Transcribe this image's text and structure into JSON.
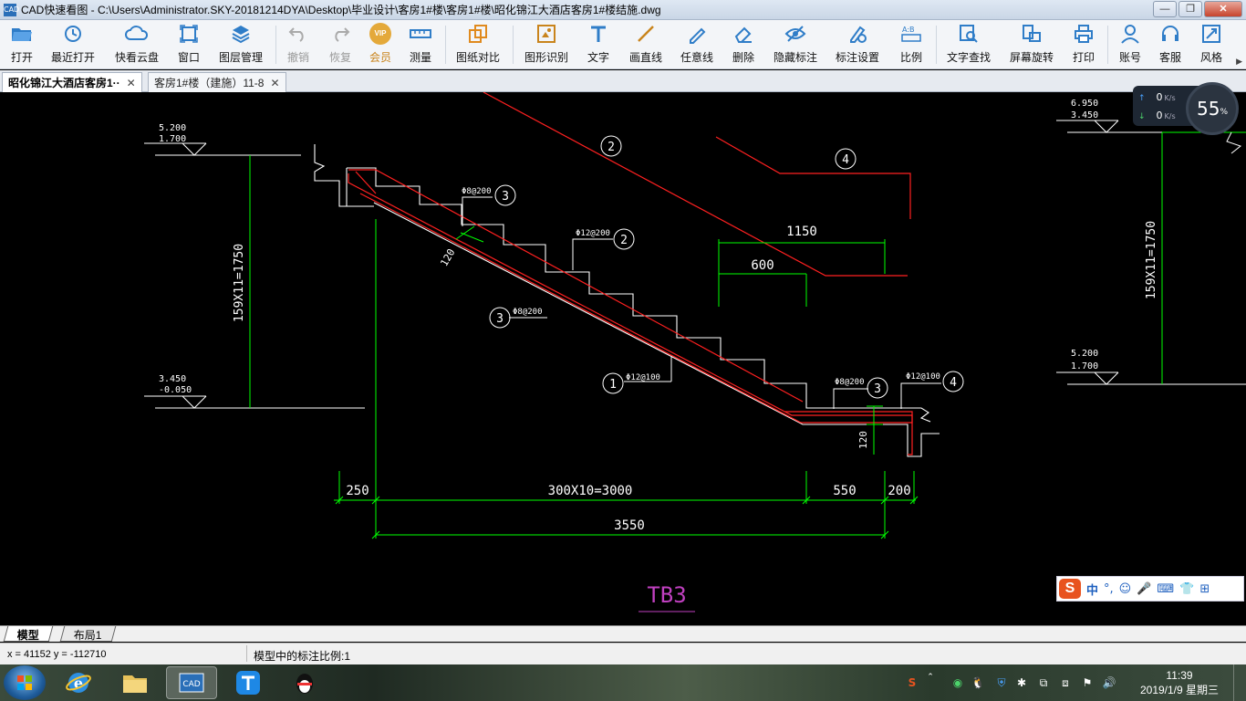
{
  "window": {
    "app_icon": "CAD",
    "title": "CAD快速看图 - C:\\Users\\Administrator.SKY-20181214DYA\\Desktop\\毕业设计\\客房1#楼\\客房1#楼\\昭化锦江大酒店客房1#楼结施.dwg",
    "minimize": "—",
    "restore": "❐",
    "close": "✕"
  },
  "toolbar": {
    "items": [
      {
        "label": "打开",
        "icon": "folder-open-icon"
      },
      {
        "label": "最近打开",
        "icon": "recent-icon"
      },
      {
        "label": "快看云盘",
        "icon": "cloud-icon"
      },
      {
        "label": "窗口",
        "icon": "window-icon"
      },
      {
        "label": "图层管理",
        "icon": "layers-icon"
      },
      {
        "label": "撤销",
        "icon": "undo-icon"
      },
      {
        "label": "恢复",
        "icon": "redo-icon"
      },
      {
        "label": "会员",
        "icon": "vip-icon"
      },
      {
        "label": "测量",
        "icon": "measure-icon"
      },
      {
        "label": "图纸对比",
        "icon": "compare-icon"
      },
      {
        "label": "图形识别",
        "icon": "shape-recognize-icon"
      },
      {
        "label": "文字",
        "icon": "text-icon"
      },
      {
        "label": "画直线",
        "icon": "line-icon"
      },
      {
        "label": "任意线",
        "icon": "freehand-icon"
      },
      {
        "label": "删除",
        "icon": "eraser-icon"
      },
      {
        "label": "隐藏标注",
        "icon": "eye-hide-icon"
      },
      {
        "label": "标注设置",
        "icon": "annotation-settings-icon"
      },
      {
        "label": "比例",
        "icon": "scale-icon"
      },
      {
        "label": "文字查找",
        "icon": "text-search-icon"
      },
      {
        "label": "屏幕旋转",
        "icon": "rotate-screen-icon"
      },
      {
        "label": "打印",
        "icon": "printer-icon"
      },
      {
        "label": "账号",
        "icon": "account-icon"
      },
      {
        "label": "客服",
        "icon": "headset-icon"
      },
      {
        "label": "风格",
        "icon": "style-icon"
      }
    ],
    "vip_text": "VIP",
    "expand": "▶"
  },
  "tabs": [
    {
      "label": "昭化锦江大酒店客房1··",
      "close": "✕",
      "active": true
    },
    {
      "label": "客房1#楼（建施）11-8",
      "close": "✕",
      "active": false
    }
  ],
  "drawing": {
    "left_level_top": [
      "5.200",
      "1.700"
    ],
    "left_level_bottom": [
      "3.450",
      "-0.050"
    ],
    "right_level_top": [
      "6.950",
      "3.450"
    ],
    "right_level_bottom": [
      "5.200",
      "1.700"
    ],
    "left_height_dim": "159X11=1750",
    "right_height_dim": "159X11=1750",
    "thickness_left": "120",
    "thickness_right": "120",
    "rebar_labels": [
      {
        "text": "Φ8@200",
        "num": "3"
      },
      {
        "text": "Φ12@200",
        "num": "2"
      },
      {
        "text": "Φ8@200",
        "num": "3"
      },
      {
        "text": "Φ12@100",
        "num": "1"
      },
      {
        "text": "Φ8@200",
        "num": "3"
      },
      {
        "text": "Φ12@100",
        "num": "4"
      }
    ],
    "detail_labels": {
      "bar2": "2",
      "bar4": "4",
      "dim_1150": "1150",
      "dim_600": "600"
    },
    "bottom_dims": {
      "d250": "250",
      "d3000": "300X10=3000",
      "d550": "550",
      "d200": "200",
      "total": "3550"
    },
    "drawing_title": "TB3"
  },
  "net_widget": {
    "up": "0",
    "down": "0",
    "unit": "K/s",
    "percent": "55",
    "percent_sign": "%"
  },
  "ime": {
    "logo": "S",
    "lang": "中",
    "punct": "°,",
    "icons": [
      "☺",
      "🎤",
      "⌨",
      "👕",
      "⊞"
    ]
  },
  "layout_tabs": [
    "模型",
    "布局1"
  ],
  "status": {
    "coords": "x = 41152  y = -112710",
    "scale": "模型中的标注比例:1"
  },
  "taskbar": {
    "tray": [
      "S",
      "⌃",
      "◉",
      "🐧",
      "⛨",
      "✱",
      "⧉",
      "⧈",
      "⚑",
      "🔊"
    ],
    "time": "11:39",
    "date": "2019/1/9 星期三"
  },
  "colors": {
    "cad_white": "#ffffff",
    "cad_green": "#00ff00",
    "cad_red": "#ff2020",
    "cad_magenta": "#c040c0"
  }
}
